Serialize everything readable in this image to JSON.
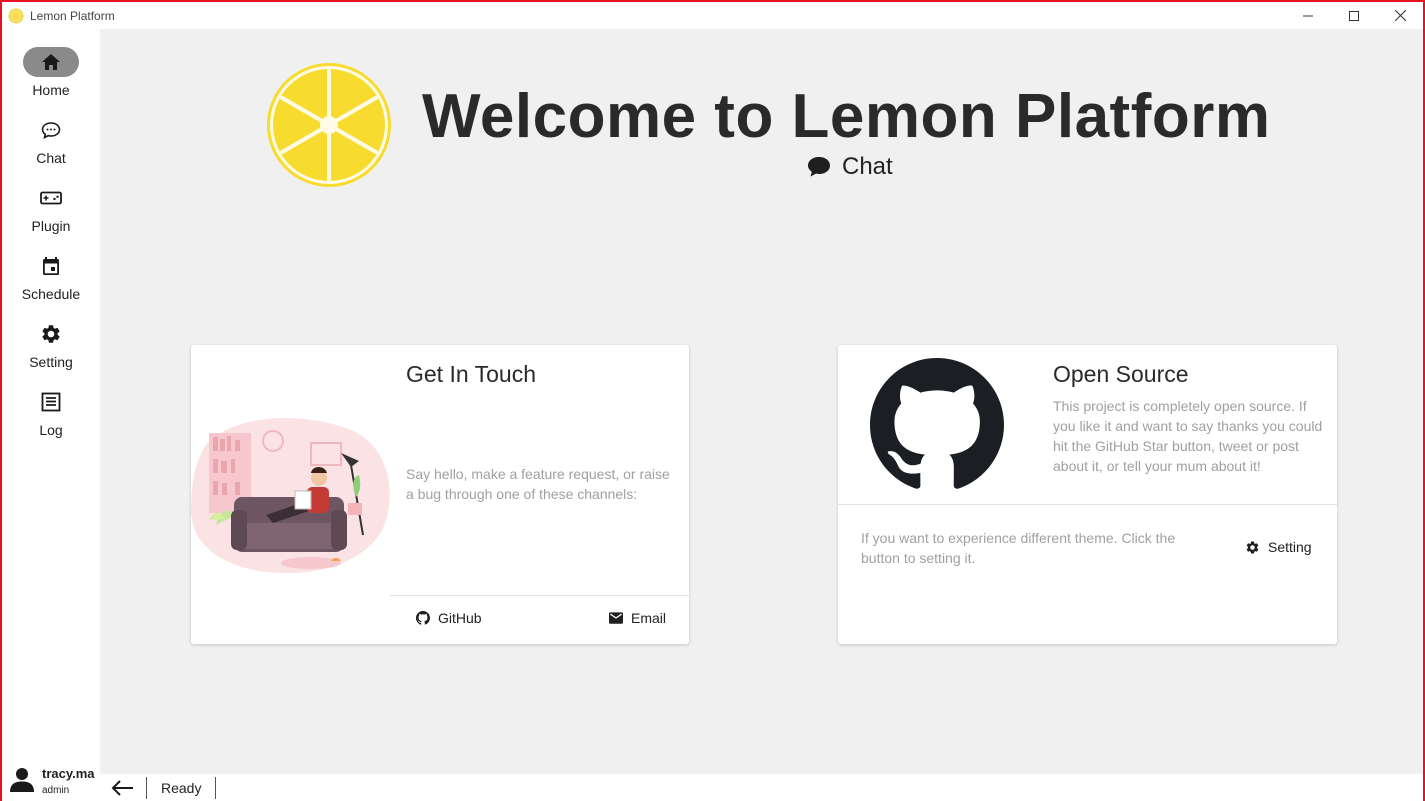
{
  "window": {
    "title": "Lemon Platform",
    "controls": [
      "minimize",
      "maximize",
      "close"
    ]
  },
  "sidebar": {
    "items": [
      {
        "label": "Home",
        "icon": "home-icon",
        "active": true
      },
      {
        "label": "Chat",
        "icon": "chat-bubble-icon",
        "active": false
      },
      {
        "label": "Plugin",
        "icon": "gamepad-icon",
        "active": false
      },
      {
        "label": "Schedule",
        "icon": "calendar-icon",
        "active": false
      },
      {
        "label": "Setting",
        "icon": "gear-icon",
        "active": false
      },
      {
        "label": "Log",
        "icon": "log-icon",
        "active": false
      }
    ],
    "user": {
      "name": "tracy.ma",
      "role": "admin"
    }
  },
  "hero": {
    "title": "Welcome to Lemon Platform",
    "subtitle": "Chat",
    "logo": "lemon-slice-logo"
  },
  "touch_card": {
    "title": "Get In Touch",
    "text": "Say hello, make a feature request, or raise a bug through one of these channels:",
    "illustration": "person-reading-on-sofa-illustration",
    "github_label": "GitHub",
    "email_label": "Email"
  },
  "source_card": {
    "title": "Open Source",
    "text": "This project is completely open source. If you like it and want to say thanks you could hit the GitHub Star button, tweet or post about it, or tell your mum about it!",
    "theme_text": "If you want to experience different theme. Click the button to setting it.",
    "setting_label": "Setting",
    "logo": "github-octocat-logo"
  },
  "statusbar": {
    "status": "Ready"
  },
  "colors": {
    "accent_border": "#e81123",
    "lemon": "#f7dc2f",
    "active_nav": "#8a8a8a"
  }
}
